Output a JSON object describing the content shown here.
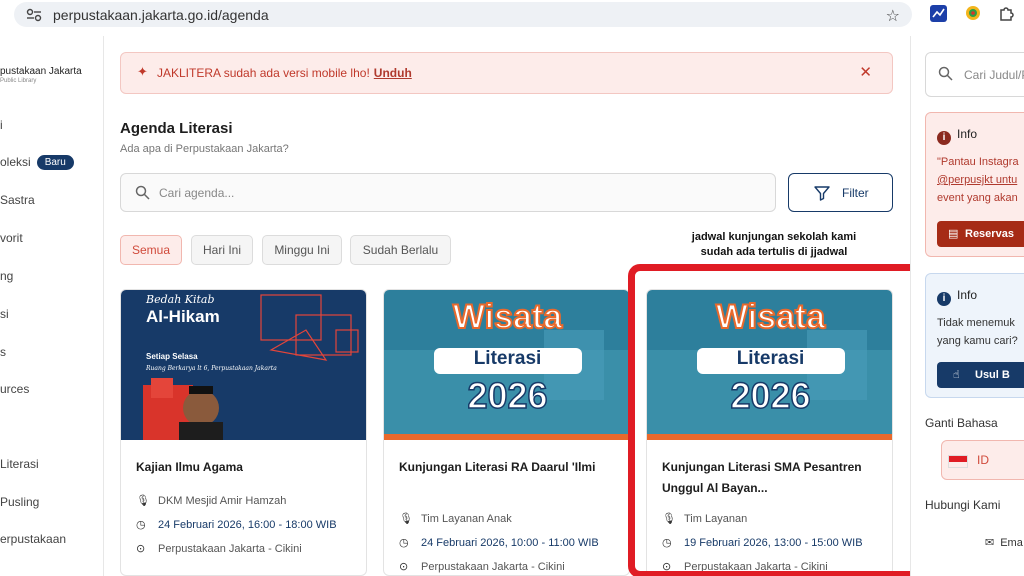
{
  "browser": {
    "url": "perpustakaan.jakarta.go.id/agenda"
  },
  "sidebar": {
    "logo_title": "pustakaan Jakarta",
    "logo_subtitle": "Public Library",
    "items": [
      {
        "label": "i"
      },
      {
        "label": "oleksi",
        "badge": "Baru"
      },
      {
        "label": "Sastra"
      },
      {
        "label": "vorit"
      },
      {
        "label": "ng"
      },
      {
        "label": "si"
      },
      {
        "label": "s"
      },
      {
        "label": "urces"
      },
      {
        "label": "Literasi"
      },
      {
        "label": "Pusling"
      },
      {
        "label": "erpustakaan"
      }
    ]
  },
  "banner": {
    "text": "JAKLITERA sudah ada versi mobile lho!",
    "link": "Unduh"
  },
  "header": {
    "title": "Agenda Literasi",
    "subtitle": "Ada apa di Perpustakaan Jakarta?"
  },
  "search": {
    "placeholder": "Cari agenda..."
  },
  "filter_label": "Filter",
  "chips": [
    "Semua",
    "Hari Ini",
    "Minggu Ini",
    "Sudah Berlalu"
  ],
  "annotation": "jadwal kunjungan sekolah kami sudah ada tertulis di jjadwal",
  "cards": [
    {
      "img_top": "Bedah Kitab",
      "img_title": "Al-Hikam",
      "img_line1": "Setiap Selasa",
      "img_line2": "Ruang Berkarya lt 6, Perpustakaan Jakarta",
      "title": "Kajian Ilmu Agama",
      "speaker": "DKM Mesjid Amir Hamzah",
      "date": "24 Februari 2026, 16:00 - 18:00 WIB",
      "location": "Perpustakaan Jakarta - Cikini"
    },
    {
      "img_word1": "Wisata",
      "img_word2": "Literasi",
      "img_year": "2026",
      "title": "Kunjungan Literasi RA Daarul 'Ilmi",
      "speaker": "Tim Layanan Anak",
      "date": "24 Februari 2026, 10:00 - 11:00 WIB",
      "location": "Perpustakaan Jakarta - Cikini"
    },
    {
      "img_word1": "Wisata",
      "img_word2": "Literasi",
      "img_year": "2026",
      "title": "Kunjungan Literasi SMA Pesantren Unggul Al Bayan...",
      "speaker": "Tim Layanan",
      "date": "19 Februari 2026, 13:00 - 15:00 WIB",
      "location": "Perpustakaan Jakarta - Cikini"
    }
  ],
  "right": {
    "search_placeholder": "Cari Judul/P",
    "info1_title": "Info",
    "info1_line1": "\"Pantau Instagra",
    "info1_line2": "@perpusjkt untu",
    "info1_line3": "event yang akan",
    "info1_button": "Reservas",
    "info2_title": "Info",
    "info2_line1": "Tidak menemuk",
    "info2_line2": "yang kamu cari?",
    "info2_button": "Usul B",
    "lang_title": "Ganti Bahasa",
    "lang_value": "ID",
    "contact_title": "Hubungi Kami",
    "email_label": "Ema"
  }
}
